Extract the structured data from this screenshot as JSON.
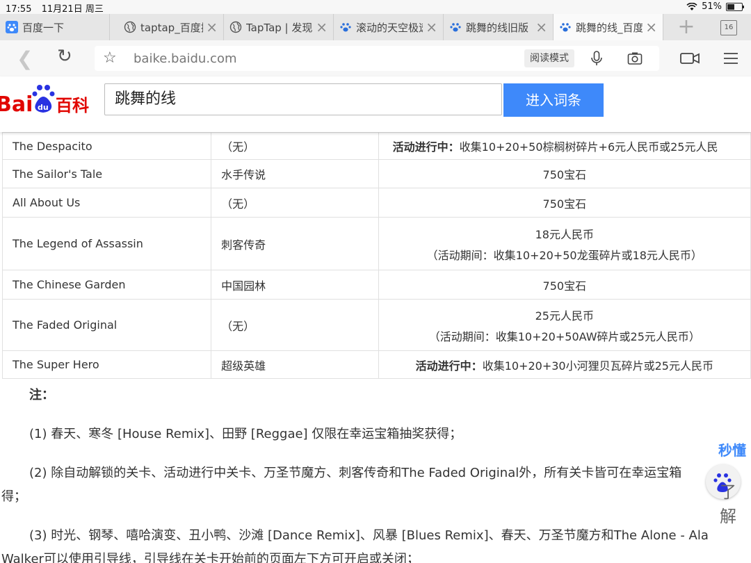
{
  "status": {
    "time": "17:55",
    "date": "11月21日 周三",
    "battery": "51%"
  },
  "tabs": [
    {
      "label": "百度一下"
    },
    {
      "label": "taptap_百度搜"
    },
    {
      "label": "TapTap | 发现"
    },
    {
      "label": "滚动的天空极速"
    },
    {
      "label": "跳舞的线旧版"
    },
    {
      "label": "跳舞的线_百度"
    }
  ],
  "tab_count": "16",
  "address": {
    "url": "baike.baidu.com",
    "reader_mode": "阅读模式"
  },
  "header": {
    "logo_text": "百科",
    "query": "跳舞的线",
    "enter_button": "进入词条"
  },
  "table": {
    "rows": [
      {
        "name": "The Despacito",
        "cn": "（无）",
        "price_bold": "活动进行中：",
        "price": "收集10+20+50棕榈树碎片+6元人民币或25元人民",
        "price_sub": ""
      },
      {
        "name": "The Sailor's Tale",
        "cn": "水手传说",
        "price_bold": "",
        "price": "750宝石",
        "price_sub": ""
      },
      {
        "name": "All About Us",
        "cn": "（无）",
        "price_bold": "",
        "price": "750宝石",
        "price_sub": ""
      },
      {
        "name": "The Legend of Assassin",
        "cn": "刺客传奇",
        "price_bold": "",
        "price": "18元人民币",
        "price_sub": "（活动期间：收集10+20+50龙蛋碎片或18元人民币）"
      },
      {
        "name": "The Chinese Garden",
        "cn": "中国园林",
        "price_bold": "",
        "price": "750宝石",
        "price_sub": ""
      },
      {
        "name": "The Faded Original",
        "cn": "（无）",
        "price_bold": "",
        "price": "25元人民币",
        "price_sub": "（活动期间：收集10+20+50AW碎片或25元人民币）"
      },
      {
        "name": "The Super Hero",
        "cn": "超级英雄",
        "price_bold": "活动进行中：",
        "price": "收集10+20+30小河狸贝瓦碎片或25元人民币",
        "price_sub": ""
      }
    ]
  },
  "notes": {
    "title": "注：",
    "n1": "(1) 春天、寒冬 [House Remix]、田野 [Reggae] 仅限在幸运宝箱抽奖获得；",
    "n2a": "(2) 除自动解锁的关卡、活动进行中关卡、万圣节魔方、刺客传奇和The Faded Original外，所有关卡皆可在幸运宝箱",
    "n2b": "得；",
    "n3a": "(3) 时光、钢琴、嘻哈演变、丑小鸭、沙滩 [Dance Remix]、风暴 [Blues Remix]、春天、万圣节魔方和The Alone - Ala",
    "n3b": "Walker可以使用引导线，引导线在关卡开始前的页面左下方可开启或关闭；"
  },
  "float_widget": {
    "line1": "秒懂",
    "line2": "了解"
  },
  "colors": {
    "accent": "#3e89fa",
    "baidu_red": "#e10601",
    "baidu_blue": "#2932e1"
  }
}
